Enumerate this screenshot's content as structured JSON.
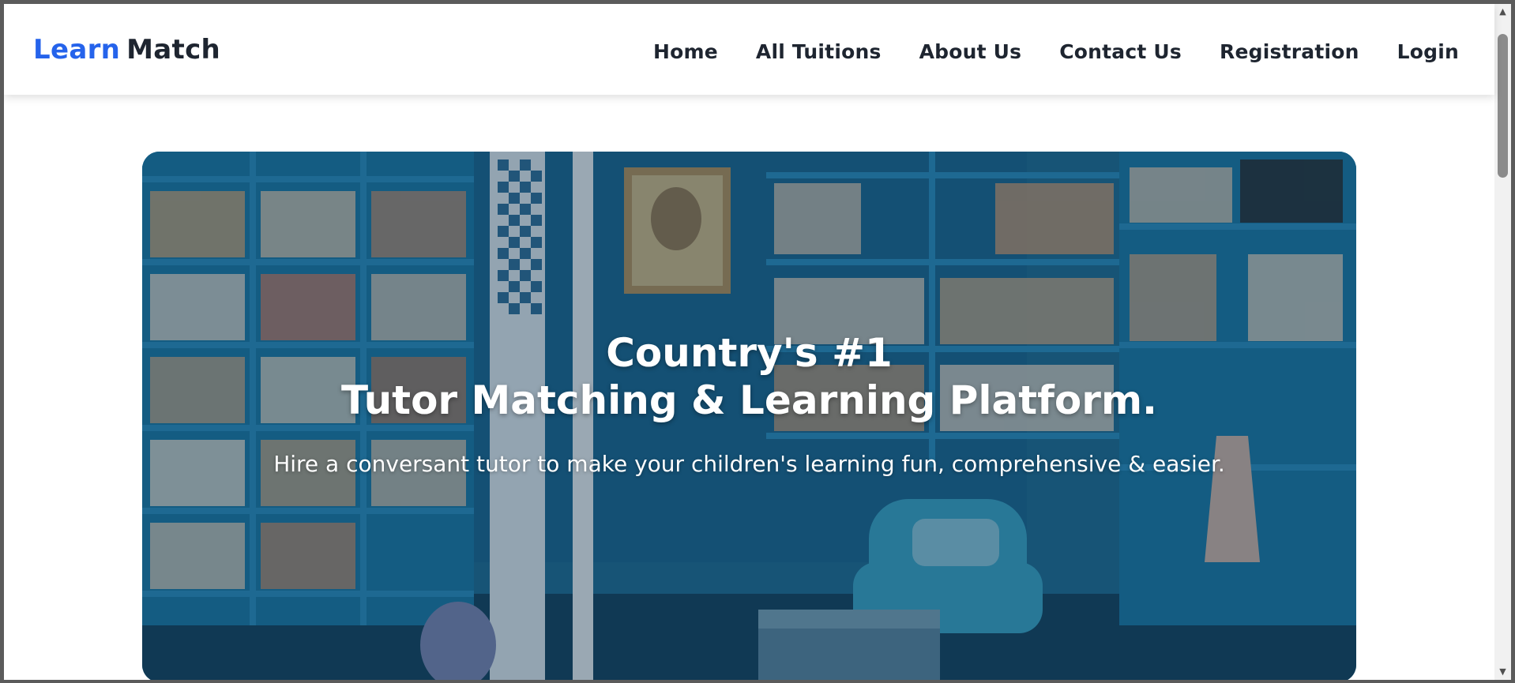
{
  "brand": {
    "part1": "Learn",
    "part2": "Match"
  },
  "nav": {
    "items": [
      "Home",
      "All Tuitions",
      "About Us",
      "Contact Us",
      "Registration",
      "Login"
    ]
  },
  "hero": {
    "title_line1": "Country's #1",
    "title_line2": "Tutor Matching & Learning Platform.",
    "subtitle": "Hire a conversant tutor to make your children's learning fun, comprehensive & easier."
  },
  "colors": {
    "brand_accent": "#2563eb",
    "text_dark": "#1e2530",
    "hero_tint": "#1e5f80"
  },
  "icons": [
    "scroll-up-icon",
    "scroll-down-icon"
  ]
}
